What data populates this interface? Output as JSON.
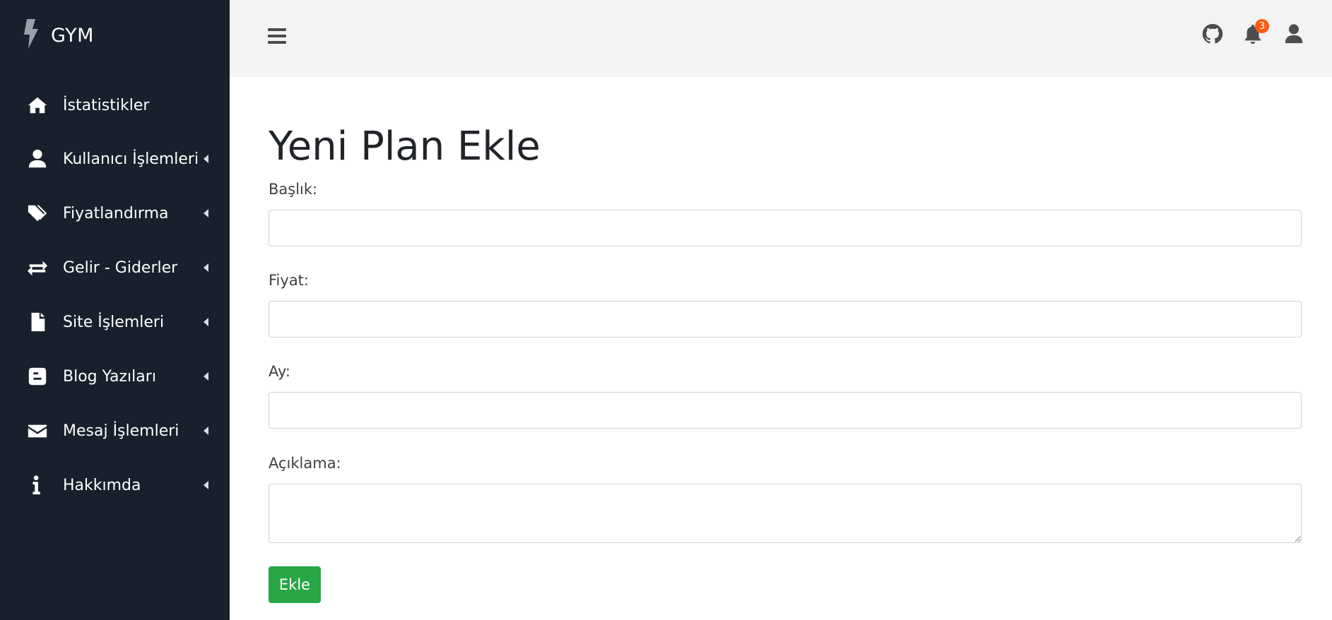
{
  "brand": {
    "name": "GYM",
    "icon": "bolt-icon"
  },
  "sidebar": {
    "items": [
      {
        "label": "İstatistikler",
        "icon": "home-icon",
        "has_submenu": false
      },
      {
        "label": "Kullanıcı İşlemleri",
        "icon": "user-icon",
        "has_submenu": true
      },
      {
        "label": "Fiyatlandırma",
        "icon": "tags-icon",
        "has_submenu": true
      },
      {
        "label": "Gelir - Giderler",
        "icon": "exchange-icon",
        "has_submenu": true
      },
      {
        "label": "Site İşlemleri",
        "icon": "file-icon",
        "has_submenu": true
      },
      {
        "label": "Blog Yazıları",
        "icon": "blogger-icon",
        "has_submenu": true
      },
      {
        "label": "Mesaj İşlemleri",
        "icon": "envelope-icon",
        "has_submenu": true
      },
      {
        "label": "Hakkımda",
        "icon": "info-icon",
        "has_submenu": true
      }
    ]
  },
  "topbar": {
    "menu_icon": "hamburger-icon",
    "icons": [
      "github-icon",
      "bell-icon",
      "user-icon"
    ],
    "notification_count": "3"
  },
  "main": {
    "title": "Yeni Plan Ekle",
    "fields": [
      {
        "label": "Başlık:",
        "value": "",
        "type": "text"
      },
      {
        "label": "Fiyat:",
        "value": "",
        "type": "text"
      },
      {
        "label": "Ay:",
        "value": "",
        "type": "text"
      },
      {
        "label": "Açıklama:",
        "value": "",
        "type": "textarea"
      }
    ],
    "submit_label": "Ekle"
  },
  "colors": {
    "sidebar_bg": "#18202d",
    "topbar_bg": "#f3f3f3",
    "badge": "#ff5a13",
    "submit": "#28a745"
  }
}
